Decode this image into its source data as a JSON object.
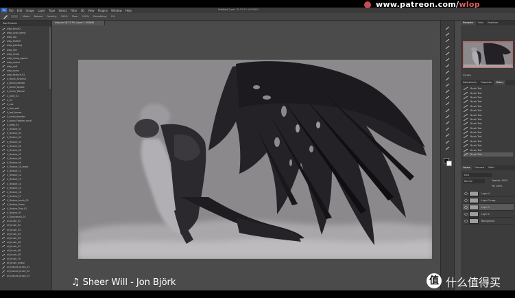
{
  "app": {
    "document_title": "Untitled-1.psd",
    "document_subtitle": "@ 33.3% (RGB/8*)"
  },
  "watermark": {
    "patreon_prefix": "www.patreon.com/",
    "patreon_handle": "wlop"
  },
  "menubar": {
    "app_logo": "Ps",
    "items": [
      "File",
      "Edit",
      "Image",
      "Layer",
      "Type",
      "Select",
      "Filter",
      "3D",
      "View",
      "Plugins",
      "Window",
      "Help"
    ]
  },
  "options": {
    "mode_label": "Mode:",
    "mode_value": "Normal",
    "opacity_label": "Opacity:",
    "opacity_value": "100%",
    "flow_label": "Flow:",
    "flow_value": "100%",
    "smoothing_label": "Smoothing:",
    "smoothing_value": "0%"
  },
  "brush_panel": {
    "title": "Tool Presets",
    "items": [
      "wlop_brush2",
      "wlop_color_blend",
      "wlop_dot",
      "wlop_feather",
      "wlop_painting",
      "wlop_rain",
      "wlop_sharp",
      "wlop_sharp_square",
      "wlop_smear",
      "wlop_soft",
      "wlop_spray",
      "wlop_texture_02",
      "4_Brush_Airbrush",
      "4_Brush_blender",
      "4_Brush_Square",
      "4_brush_Texture",
      "4_cloth_01",
      "4_fur",
      "4_hair",
      "4_Hair_soft",
      "4_leaf_leaves",
      "4_brush_blender",
      "4_brush_Feather_scroll",
      "4_petal_04",
      "4_Texture_01",
      "4_Texture_02",
      "4_Texture_03",
      "4_Texture_04",
      "4_Texture_05",
      "4_Texture_06",
      "4_Texture_07",
      "4_Texture_08",
      "4_Texture_09",
      "4_Texture_10_stone",
      "4_Texture_11",
      "4_Texture_12",
      "4_Texture_13",
      "4_Texture_14",
      "4_Texture_15",
      "4_Texture_16",
      "4_Texture_17",
      "4_Texture_brush_03",
      "4_Texture_Grass",
      "4_Texture_Tree_02",
      "4_Texture_03",
      "4_Stonybrush_03",
      "all_brush_01",
      "all_brush_02",
      "all_brush_03",
      "all_brush_04",
      "all_brush_05",
      "all_brush_06",
      "all_brush_07",
      "all_brush_08",
      "all_brush_09",
      "all_brush_10",
      "all_brush_smear",
      "all_texture_brush_01",
      "all_texture_brush_02",
      "all_texture_brush_03"
    ]
  },
  "doc_tab": {
    "label": "wlop.psd @ 33.3% (Layer 2, RGB/8)"
  },
  "right_panel": {
    "nav_tabs": [
      "Navigator",
      "Color",
      "Swatches"
    ],
    "zoom": "33.33%",
    "history_tabs": [
      "Adjustments",
      "Properties",
      "History"
    ],
    "history_items": [
      "Brush Tool",
      "Brush Tool",
      "Brush Tool",
      "Brush Tool",
      "Brush Tool",
      "Brush Tool",
      "Brush Tool",
      "Brush Tool",
      "Brush Tool",
      "Brush Tool",
      "Brush Tool",
      "Brush Tool",
      "Brush Tool",
      "Brush Tool",
      "Brush Tool",
      "Brush Tool"
    ],
    "layers_tabs": [
      "Layers",
      "Channels",
      "Paths"
    ],
    "kind_label": "Kind",
    "mode_value": "Normal",
    "opacity_label": "Opacity: 100%",
    "fill_label": "Fill: 100%",
    "layers": [
      "Layer 4",
      "Layer 3 copy",
      "Layer 3",
      "Layer 2",
      "Background"
    ]
  },
  "overlay": {
    "song_title": "Sheer Will - Jon Björk",
    "site_name": "什么值得买",
    "site_logo": "值"
  },
  "colors": {
    "canvas_bg": "#8b898c",
    "wing_dark": "#1f1d22",
    "ui_dark": "#3c3c3c",
    "patreon_accent": "#c84b4b"
  }
}
